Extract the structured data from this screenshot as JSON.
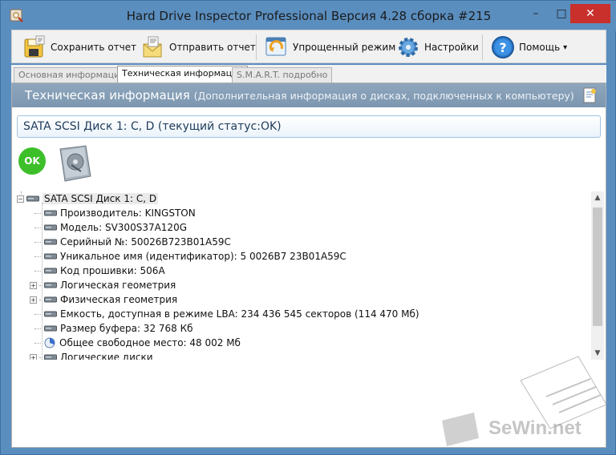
{
  "window": {
    "title": "Hard Drive Inspector Professional Версия 4.28 сборка #215",
    "controls": {
      "minimize": "–",
      "maximize": "□",
      "close": "✕"
    }
  },
  "toolbar": {
    "save_report": "Сохранить отчет",
    "send_report": "Отправить отчет",
    "simple_mode": "Упрощенный режим",
    "settings": "Настройки",
    "help": "Помощь",
    "help_dropdown_icon": "▾"
  },
  "tabs": [
    {
      "label": "Основная информация",
      "active": false
    },
    {
      "label": "Техническая информация",
      "active": true
    },
    {
      "label": "S.M.A.R.T. подробно",
      "active": false
    }
  ],
  "header": {
    "title": "Техническая информация",
    "subtitle": "(Дополнительная информация о дисках, подключенных к компьютеру)"
  },
  "disk": {
    "title": "SATA SCSI Диск 1: C, D (текущий статус:OK)",
    "status_badge": "OK"
  },
  "tree": {
    "root": "SATA SCSI Диск 1: C, D",
    "items": [
      {
        "label": "Производитель: KINGSTON",
        "expandable": false,
        "icon": "hdd-icon"
      },
      {
        "label": "Модель: SV300S37A120G",
        "expandable": false,
        "icon": "hdd-icon"
      },
      {
        "label": "Серийный №: 50026B723B01A59C",
        "expandable": false,
        "icon": "hdd-icon"
      },
      {
        "label": "Уникальное имя (идентификатор): 5 0026B7 23B01A59C",
        "expandable": false,
        "icon": "hdd-icon"
      },
      {
        "label": "Код прошивки: 506A",
        "expandable": false,
        "icon": "hdd-icon"
      },
      {
        "label": "Логическая геометрия",
        "expandable": true,
        "icon": "hdd-icon"
      },
      {
        "label": "Физическая геометрия",
        "expandable": true,
        "icon": "hdd-icon"
      },
      {
        "label": "Емкость, доступная в режиме LBA: 234 436 545 секторов (114 470 Мб)",
        "expandable": false,
        "icon": "hdd-icon"
      },
      {
        "label": "Размер буфера: 32 768 Кб",
        "expandable": false,
        "icon": "hdd-icon"
      },
      {
        "label": "Общее свободное место: 48 002 Мб",
        "expandable": false,
        "icon": "pie-chart-icon"
      },
      {
        "label": "Логические диски",
        "expandable": true,
        "icon": "hdd-icon"
      }
    ]
  },
  "scrollbar": {
    "up": "▲",
    "down": "▼"
  },
  "watermark": {
    "text": "SeWin.net"
  },
  "colors": {
    "title_bar": "#5a8ebf",
    "header_band": "#8ea6bd",
    "ok_green": "#3dbf2a",
    "close_red": "#c9302c"
  }
}
